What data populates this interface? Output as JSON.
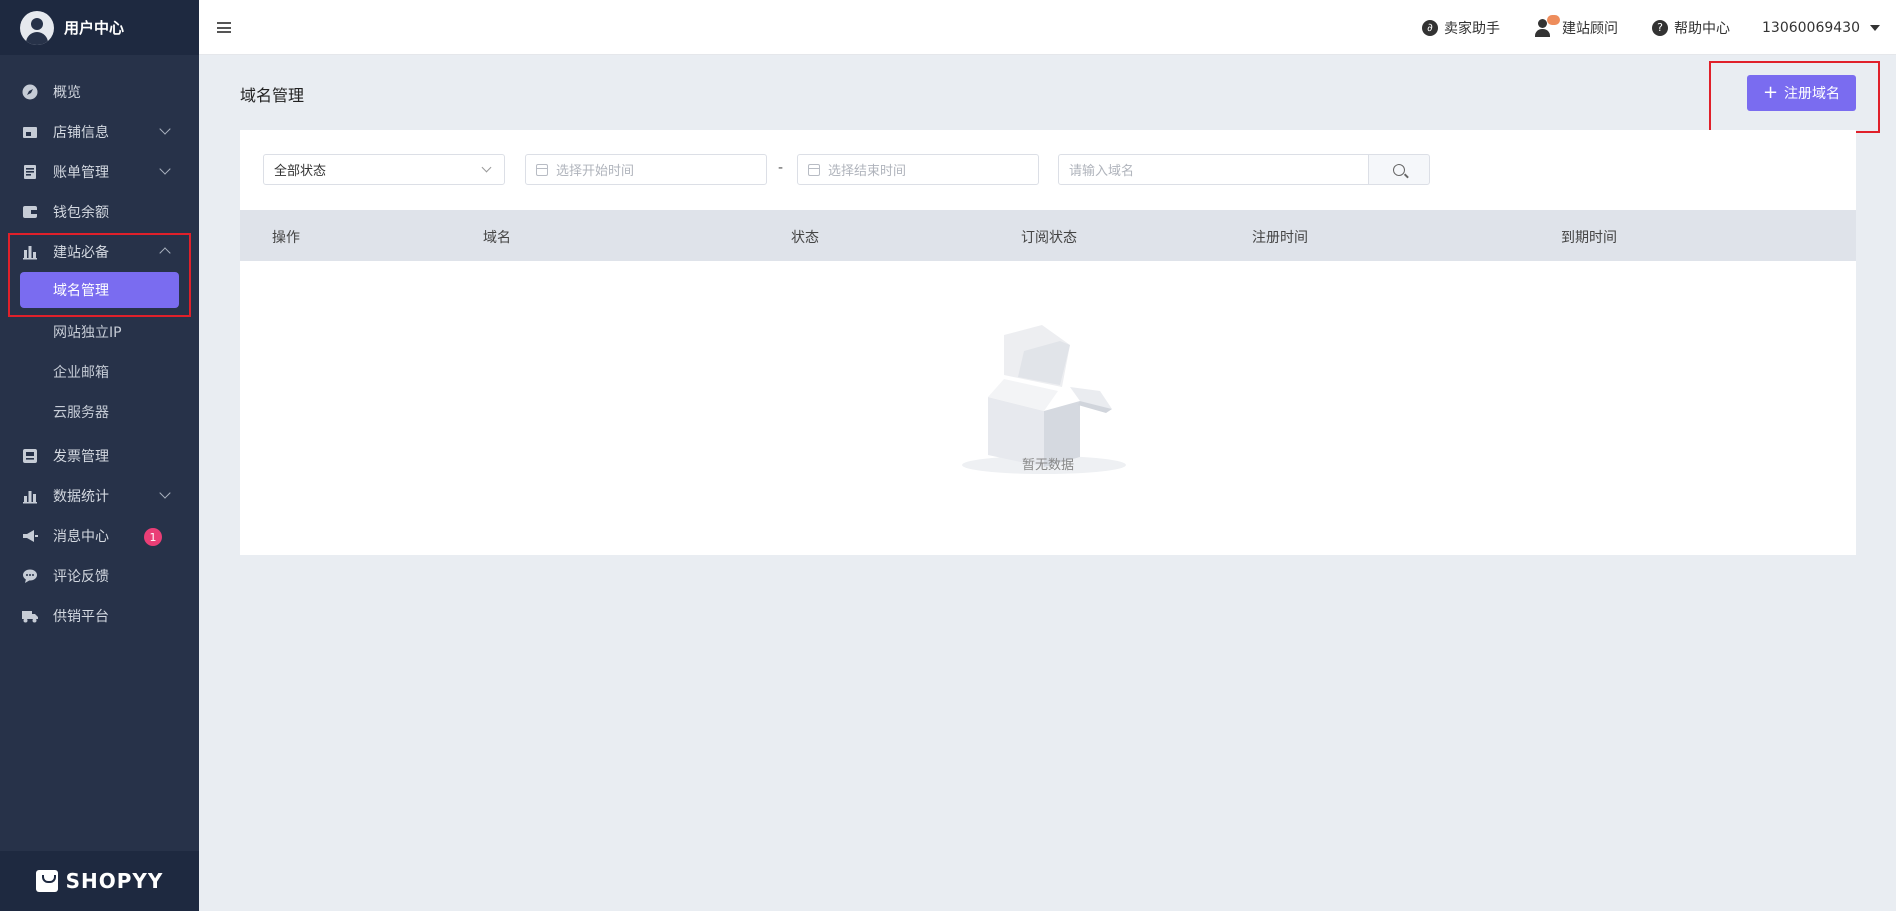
{
  "sidebar": {
    "title": "用户中心",
    "items": [
      {
        "label": "概览",
        "icon": "compass-icon"
      },
      {
        "label": "店铺信息",
        "icon": "store-icon"
      },
      {
        "label": "账单管理",
        "icon": "bill-icon"
      },
      {
        "label": "钱包余额",
        "icon": "wallet-icon"
      },
      {
        "label": "建站必备",
        "icon": "bar-chart-icon"
      }
    ],
    "sub_items": [
      "域名管理",
      "网站独立IP",
      "企业邮箱",
      "云服务器"
    ],
    "items_after": [
      {
        "label": "发票管理",
        "icon": "invoice-icon"
      },
      {
        "label": "数据统计",
        "icon": "stats-icon"
      },
      {
        "label": "消息中心",
        "icon": "megaphone-icon",
        "badge": "1"
      },
      {
        "label": "评论反馈",
        "icon": "comment-icon"
      },
      {
        "label": "供销平台",
        "icon": "truck-icon"
      }
    ],
    "brand": "SHOPYY"
  },
  "topbar": {
    "seller_assistant": "卖家助手",
    "site_consultant": "建站顾问",
    "help_center": "帮助中心",
    "account": "13060069430"
  },
  "main": {
    "page_title": "域名管理",
    "register_button": "注册域名",
    "filters": {
      "status_value": "全部状态",
      "start_placeholder": "选择开始时间",
      "range_separator": "-",
      "end_placeholder": "选择结束时间",
      "domain_placeholder": "请输入域名"
    },
    "table": {
      "columns": [
        "操作",
        "域名",
        "状态",
        "订阅状态",
        "注册时间",
        "到期时间"
      ],
      "empty_text": "暂无数据"
    }
  },
  "colors": {
    "accent": "#7a6cf0",
    "sidebar": "#273249",
    "highlight_box": "#e0202a"
  }
}
